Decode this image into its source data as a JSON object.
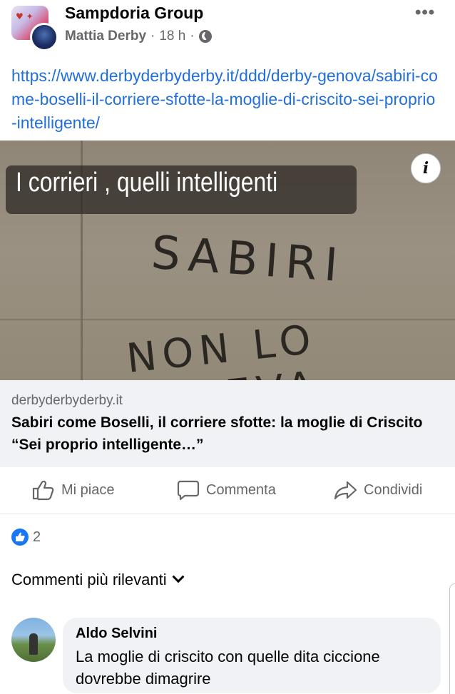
{
  "post": {
    "group_name": "Sampdoria Group",
    "author": "Mattia Derby",
    "time": "18 h",
    "separator": "·",
    "more_icon": "more-horizontal-icon",
    "link_text": "https://www.derbyderbyderby.it/ddd/derby-genova/sabiri-come-boselli-il-corriere-sfotte-la-moglie-di-criscito-sei-proprio-intelligente/"
  },
  "image": {
    "caption": "I corrieri , quelli intelligenti",
    "handwriting_line1": "SABIRI",
    "handwriting_line2": "NON LO SAPEVA"
  },
  "preview": {
    "domain": "derbyderbyderby.it",
    "title": "Sabiri come Boselli, il corriere sfotte: la moglie di Criscito “Sei proprio intelligente…”"
  },
  "actions": {
    "like": "Mi piace",
    "comment": "Commenta",
    "share": "Condividi"
  },
  "reactions": {
    "count": "2"
  },
  "comments": {
    "sort_label": "Commenti più rilevanti",
    "items": [
      {
        "name": "Aldo Selvini",
        "text": "La moglie di criscito con quelle dita ciccione dovrebbe dimagrire"
      }
    ]
  },
  "colors": {
    "link": "#216fdb",
    "secondary_text": "#65676b",
    "like_blue": "#1877f2",
    "bubble_bg": "#f0f2f5"
  }
}
